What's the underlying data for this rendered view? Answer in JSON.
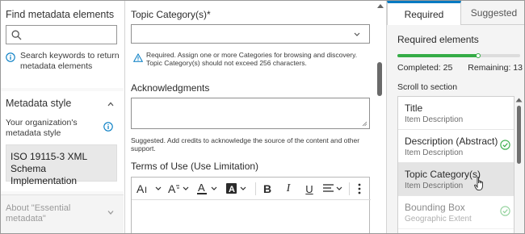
{
  "left": {
    "find_title": "Find metadata elements",
    "search_placeholder": "",
    "search_hint": "Search keywords to return metadata elements",
    "style_title": "Metadata style",
    "style_desc": "Your organization's metadata style",
    "style_value": "ISO 19115-3 XML Schema Implementation",
    "about_label": "About \"Essential metadata\""
  },
  "form": {
    "topic_label": "Topic Category(s)*",
    "topic_value": "",
    "topic_warning": "Required. Assign one or more Categories for browsing and discovery. Topic Category(s) should not exceed 256 characters.",
    "ack_label": "Acknowledgments",
    "ack_value": "",
    "ack_help": "Suggested. Add credits to acknowledge the source of the content and other support.",
    "terms_label": "Terms of Use (Use Limitation)",
    "toolbar": {
      "font_size_icon": "font-size-icon",
      "text_style_icon": "text-style-icon",
      "font_color_icon": "font-color-icon",
      "highlight_icon": "highlight-icon",
      "bold_icon": "bold-icon",
      "italic_icon": "italic-icon",
      "underline_icon": "underline-icon",
      "align_icon": "align-icon",
      "more_icon": "more-vertical-icon"
    }
  },
  "right": {
    "tabs": [
      {
        "label": "Required",
        "active": true
      },
      {
        "label": "Suggested",
        "active": false
      }
    ],
    "title": "Required elements",
    "completed": "Completed: 25",
    "remaining": "Remaining: 13",
    "progress_fraction": 0.66,
    "scroll_label": "Scroll to section",
    "items": [
      {
        "title": "Title",
        "subtitle": "Item Description",
        "complete": false,
        "selected": false
      },
      {
        "title": "Description (Abstract)",
        "subtitle": "Item Description",
        "complete": true,
        "selected": false
      },
      {
        "title": "Topic Category(s)",
        "subtitle": "Item Description",
        "complete": false,
        "selected": true
      },
      {
        "title": "Bounding Box",
        "subtitle": "Geographic Extent",
        "complete": true,
        "selected": false
      }
    ]
  },
  "colors": {
    "accent": "#007ac2",
    "progress": "#35ac46",
    "selected_row": "#e4e4e4"
  }
}
